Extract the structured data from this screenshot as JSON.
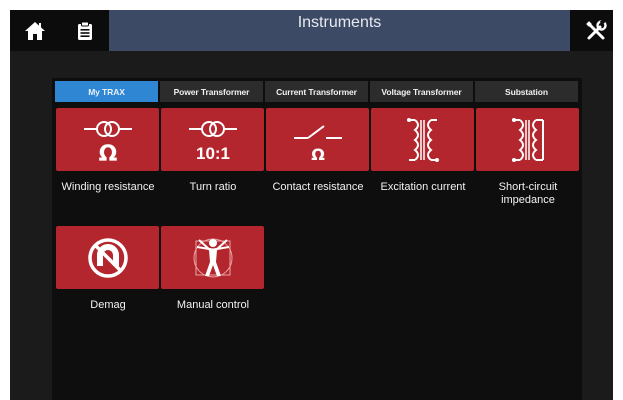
{
  "header": {
    "title": "Instruments",
    "icons": [
      "home-icon",
      "clipboard-icon",
      "tools-icon"
    ]
  },
  "tabs": [
    {
      "label": "My TRAX",
      "active": true
    },
    {
      "label": "Power Transformer",
      "active": false
    },
    {
      "label": "Current Transformer",
      "active": false
    },
    {
      "label": "Voltage Transformer",
      "active": false
    },
    {
      "label": "Substation",
      "active": false
    }
  ],
  "tiles": [
    {
      "label": "Winding resistance",
      "icon": "winding-resistance-icon",
      "glyph": "Ω"
    },
    {
      "label": "Turn ratio",
      "icon": "turn-ratio-icon",
      "glyph": "10:1"
    },
    {
      "label": "Contact resistance",
      "icon": "contact-resistance-icon",
      "glyph": "Ω"
    },
    {
      "label": "Excitation current",
      "icon": "excitation-current-icon"
    },
    {
      "label": "Short-circuit impedance",
      "icon": "short-circuit-impedance-icon"
    },
    {
      "label": "Demag",
      "icon": "demag-icon"
    },
    {
      "label": "Manual control",
      "icon": "manual-control-icon"
    }
  ],
  "colors": {
    "tile": "#b4262d",
    "active_tab": "#2f86d2",
    "title_bar": "#3d4a66",
    "background": "#1b1b1b"
  }
}
